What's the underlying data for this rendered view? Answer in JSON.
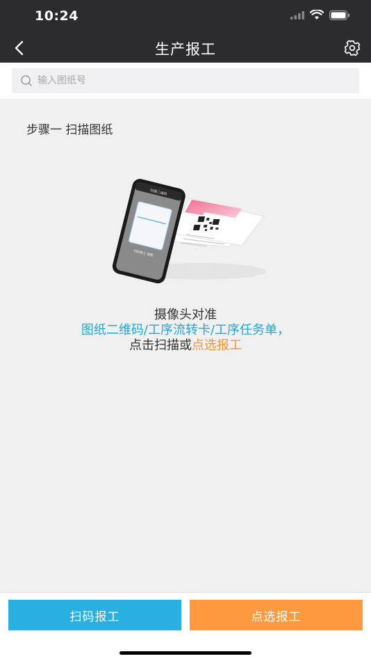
{
  "status": {
    "time": "10:24"
  },
  "nav": {
    "title": "生产报工",
    "back_icon": "chevron-left-icon",
    "settings_icon": "gear-icon"
  },
  "search": {
    "placeholder": "输入图纸号",
    "value": ""
  },
  "step": {
    "title": "步骤一  扫描图纸"
  },
  "illustration": {
    "phone_header": "扫描二维码",
    "phone_caption": "扫码报工 查看"
  },
  "instructions": {
    "line1": "摄像头对准",
    "line2": "图纸二维码/工序流转卡/工序任务单，",
    "line3_prefix": "点击扫描或",
    "line3_link": "点选报工"
  },
  "actions": {
    "scan_label": "扫码报工",
    "select_label": "点选报工"
  },
  "colors": {
    "bar": "#2c2c2e",
    "accent_blue": "#29b0e0",
    "accent_orange": "#fd9a3f",
    "text_blue": "#1ea8d8",
    "text_orange": "#f5952f"
  }
}
